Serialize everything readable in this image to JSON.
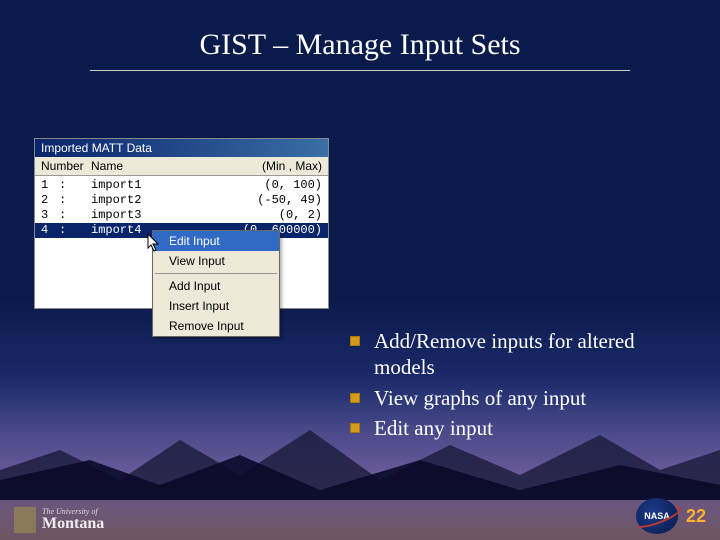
{
  "title": "GIST – Manage Input Sets",
  "panel": {
    "title": "Imported MATT Data",
    "headers": {
      "num": "Number",
      "name": "Name",
      "range": "(Min , Max)"
    },
    "rows": [
      {
        "n": "1",
        "sep": ":",
        "name": "import1",
        "range": "(0, 100)"
      },
      {
        "n": "2",
        "sep": ":",
        "name": "import2",
        "range": "(-50, 49)"
      },
      {
        "n": "3",
        "sep": ":",
        "name": "import3",
        "range": "(0, 2)"
      },
      {
        "n": "4",
        "sep": ":",
        "name": "import4",
        "range": "(0, 600000)"
      }
    ]
  },
  "menu": {
    "items1": [
      "Edit Input",
      "View Input"
    ],
    "items2": [
      "Add Input",
      "Insert Input",
      "Remove Input"
    ]
  },
  "bullets": [
    "Add/Remove inputs for altered models",
    "View graphs of any input",
    "Edit any input"
  ],
  "footer": {
    "uni_line1": "The University of",
    "uni_line2": "Montana",
    "nasa": "NASA",
    "page": "22"
  }
}
